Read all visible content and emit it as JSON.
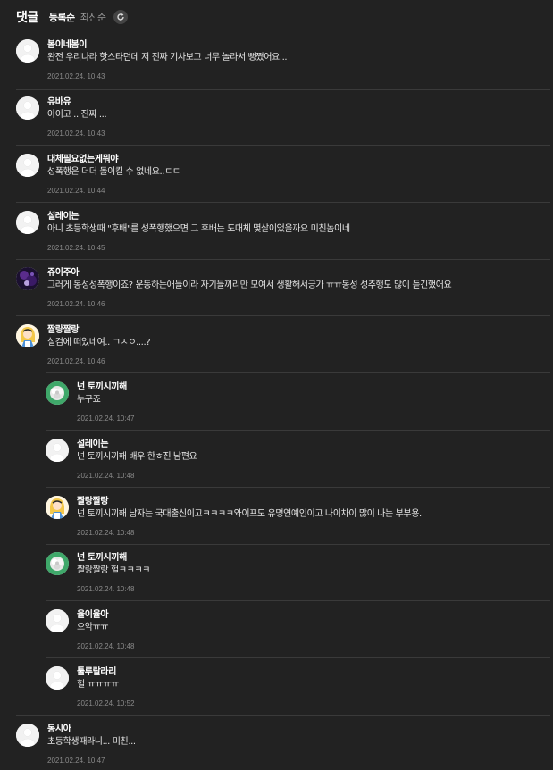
{
  "header": {
    "title": "댓글",
    "sort_popular": "등록순",
    "sort_latest": "최신순"
  },
  "comments": [
    {
      "author": "봄이네봄이",
      "text": "완전 우리나라 핫스타던데 저 진짜 기사보고 너무 놀라서 뻥쪘어요...",
      "time": "2021.02.24. 10:43",
      "avatar": "default"
    },
    {
      "author": "유바유",
      "text": "아이고 .. 진짜 ...",
      "time": "2021.02.24. 10:43",
      "avatar": "default"
    },
    {
      "author": "대체필요없는게뭐야",
      "text": "성폭행은 더더 돌이킬 수 없네요..ㄷㄷ",
      "time": "2021.02.24. 10:44",
      "avatar": "default"
    },
    {
      "author": "설레이는",
      "text": "아니 초등학생때 \"후배\"를 성폭행했으면 그 후배는 도대체 몇살이었을까요 미친놈이네",
      "time": "2021.02.24. 10:45",
      "avatar": "default"
    },
    {
      "author": "쥬이주아",
      "text": "그러게 동성성폭행이죠? 운동하는애들이라 자기들끼리만 모여서 생활해서긍가 ㅠㅠ동성 성추행도 많이 듣긴했어요",
      "time": "2021.02.24. 10:46",
      "avatar": "dark-photo"
    },
    {
      "author": "짤랑짤랑",
      "text": "실검에 떠있네여.. ㄱㅅㅇ....?",
      "time": "2021.02.24. 10:46",
      "avatar": "alice"
    },
    {
      "author": "넌 토끼시끼해",
      "text": "누구죠",
      "time": "2021.02.24. 10:47",
      "avatar": "green-flower"
    },
    {
      "author": "설레이는",
      "text": "넌 토끼시끼해 배우 한ㅎ진 남편요",
      "time": "2021.02.24. 10:48",
      "avatar": "default"
    },
    {
      "author": "짤랑짤랑",
      "text": "넌 토끼시끼해 남자는 국대출신이고ㅋㅋㅋㅋ와이프도 유명연예인이고 나이차이 많이 나는 부부용.",
      "time": "2021.02.24. 10:48",
      "avatar": "alice"
    },
    {
      "author": "넌 토끼시끼해",
      "text": "짤랑짤랑 헐ㅋㅋㅋㅋ",
      "time": "2021.02.24. 10:48",
      "avatar": "green-flower"
    },
    {
      "author": "율이율아",
      "text": "으악ㅠㅠ",
      "time": "2021.02.24. 10:48",
      "avatar": "default"
    },
    {
      "author": "툴루랄라리",
      "text": "헐 ㅠㅠㅠㅠ",
      "time": "2021.02.24. 10:52",
      "avatar": "default"
    },
    {
      "author": "동시아",
      "text": "초등학생때라니... 미친...",
      "time": "2021.02.24. 10:47",
      "avatar": "default"
    }
  ]
}
